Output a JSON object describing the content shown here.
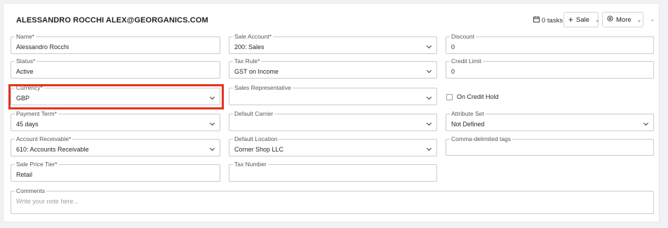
{
  "header": {
    "title": "ALESSANDRO ROCCHI ALEX@GEORGANICS.COM",
    "tasks_label": "0 tasks",
    "sale_button": "Sale",
    "more_button": "More"
  },
  "fields": {
    "name": {
      "label": "Name*",
      "value": "Alessandro Rocchi"
    },
    "sale_account": {
      "label": "Sale Account*",
      "value": "200: Sales"
    },
    "discount": {
      "label": "Discount",
      "value": "0"
    },
    "status": {
      "label": "Status*",
      "value": "Active"
    },
    "tax_rule": {
      "label": "Tax Rule*",
      "value": "GST on Income"
    },
    "credit_limit": {
      "label": "Credit Limit",
      "value": "0"
    },
    "currency": {
      "label": "Currency*",
      "value": "GBP"
    },
    "sales_rep": {
      "label": "Sales Representative",
      "value": ""
    },
    "on_credit_hold": {
      "label": "On Credit Hold",
      "checked": false
    },
    "payment_term": {
      "label": "Payment Term*",
      "value": "45 days"
    },
    "default_carrier": {
      "label": "Default Carrier",
      "value": ""
    },
    "attribute_set": {
      "label": "Attribute Set",
      "value": "Not Defined"
    },
    "account_receivable": {
      "label": "Account Receivable*",
      "value": "610: Accounts Receivable"
    },
    "default_location": {
      "label": "Default Location",
      "value": "Corner Shop LLC"
    },
    "tags": {
      "label": "Comma-delimited tags",
      "value": ""
    },
    "sale_price_tier": {
      "label": "Sale Price Tier*",
      "value": "Retail"
    },
    "tax_number": {
      "label": "Tax Number",
      "value": ""
    },
    "comments": {
      "label": "Comments",
      "placeholder": "Write your note here..."
    }
  },
  "colors": {
    "highlight": "#e3321e",
    "border": "#c8cbd1",
    "background": "#f2f2f4"
  }
}
